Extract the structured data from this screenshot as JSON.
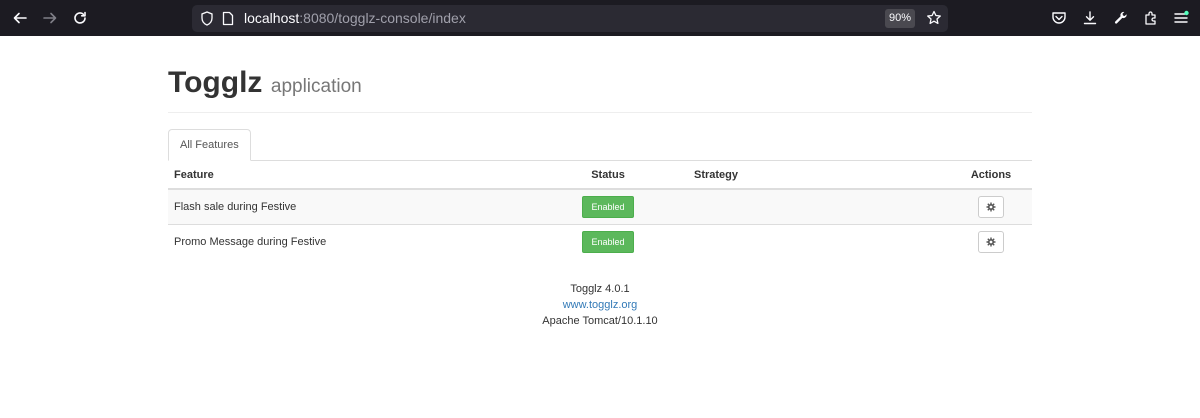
{
  "browser": {
    "url_host": "localhost",
    "url_rest": ":8080/togglz-console/index",
    "zoom": "90%",
    "icons": {
      "back": "back-arrow-icon",
      "forward": "forward-arrow-icon",
      "reload": "reload-icon",
      "shield": "shield-icon",
      "page": "page-icon",
      "bookmark": "star-icon",
      "pocket": "pocket-icon",
      "downloads": "download-icon",
      "tools": "wrench-icon",
      "extensions": "extensions-icon",
      "menu": "hamburger-menu-icon"
    }
  },
  "header": {
    "title": "Togglz",
    "subtitle": "application"
  },
  "tabs": [
    {
      "label": "All Features",
      "active": true
    }
  ],
  "table": {
    "columns": {
      "feature": "Feature",
      "status": "Status",
      "strategy": "Strategy",
      "actions": "Actions"
    },
    "rows": [
      {
        "feature": "Flash sale during Festive",
        "status": "Enabled",
        "strategy": ""
      },
      {
        "feature": "Promo Message during Festive",
        "status": "Enabled",
        "strategy": ""
      }
    ]
  },
  "footer": {
    "version": "Togglz 4.0.1",
    "link": "www.togglz.org",
    "server": "Apache Tomcat/10.1.10"
  },
  "colors": {
    "enabled": "#5cb85c",
    "link": "#337ab7",
    "browser_bg": "#1c1b22"
  }
}
